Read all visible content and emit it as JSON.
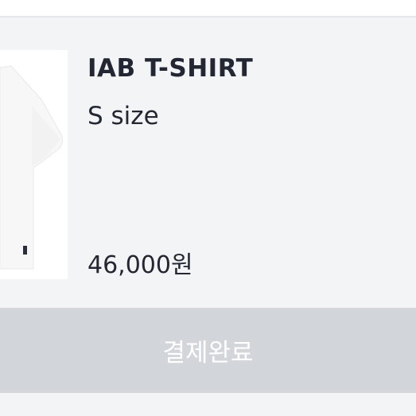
{
  "product": {
    "name": "IAB T-SHIRT",
    "option": "S size",
    "price": "46,000원"
  },
  "payment": {
    "button_label": "결제완료"
  },
  "icons": {
    "product_image": "white-tshirt-image"
  },
  "colors": {
    "background": "#f3f4f6",
    "text": "#222733",
    "button_disabled": "#d2d5da",
    "button_text": "#ffffff"
  }
}
